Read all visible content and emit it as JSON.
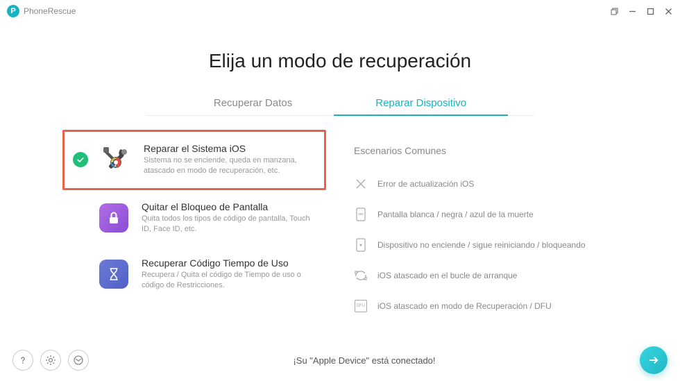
{
  "app_name": "PhoneRescue",
  "page_title": "Elija un modo de recuperación",
  "tabs": {
    "recover": "Recuperar Datos",
    "repair": "Reparar Dispositivo"
  },
  "options": {
    "repair_ios": {
      "title": "Reparar el Sistema iOS",
      "desc": "Sistema no se enciende, queda en manzana, atascado en modo de recuperación, etc."
    },
    "remove_lock": {
      "title": "Quitar el Bloqueo de Pantalla",
      "desc": "Quita todos los tipos de código de pantalla, Touch ID, Face ID, etc."
    },
    "screen_time": {
      "title": "Recuperar Código Tiempo de Uso",
      "desc": "Recupera / Quita el código de Tiempo de uso o código de Restricciones."
    }
  },
  "scenarios": {
    "title": "Escenarios Comunes",
    "items": [
      "Error de actualización iOS",
      "Pantalla blanca / negra / azul de la muerte",
      "Dispositivo no enciende / sigue reiniciando / bloqueando",
      "iOS atascado en el bucle de arranque",
      "iOS atascado en modo de Recuperación / DFU"
    ]
  },
  "dfu_label": "DFU",
  "footer_status": "¡Su \"Apple Device\" está conectado!"
}
